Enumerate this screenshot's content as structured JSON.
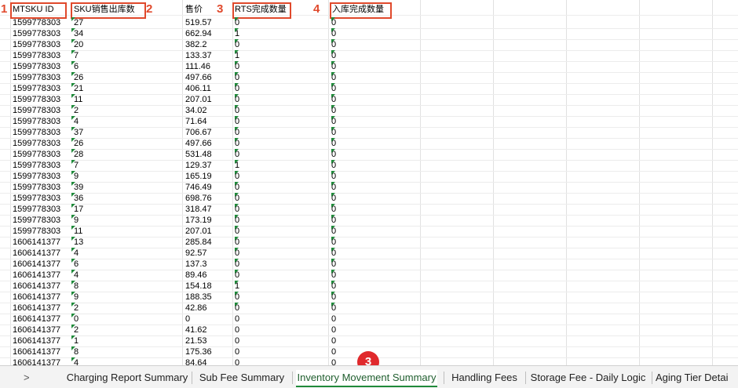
{
  "annotations": [
    "1",
    "2",
    "3",
    "4"
  ],
  "columns": {
    "mtsku_id": "MTSKU ID",
    "sku_sold": "SKU销售出库数",
    "price": "售价",
    "rts_done": "RTS完成数量",
    "inbound_done": "入库完成数量"
  },
  "rows": [
    [
      "1599778303",
      "27",
      "519.57",
      "0",
      "0"
    ],
    [
      "1599778303",
      "34",
      "662.94",
      "1",
      "0"
    ],
    [
      "1599778303",
      "20",
      "382.2",
      "0",
      "0"
    ],
    [
      "1599778303",
      "7",
      "133.37",
      "1",
      "0"
    ],
    [
      "1599778303",
      "6",
      "111.46",
      "0",
      "0"
    ],
    [
      "1599778303",
      "26",
      "497.66",
      "0",
      "0"
    ],
    [
      "1599778303",
      "21",
      "406.11",
      "0",
      "0"
    ],
    [
      "1599778303",
      "11",
      "207.01",
      "0",
      "0"
    ],
    [
      "1599778303",
      "2",
      "34.02",
      "0",
      "0"
    ],
    [
      "1599778303",
      "4",
      "71.64",
      "0",
      "0"
    ],
    [
      "1599778303",
      "37",
      "706.67",
      "0",
      "0"
    ],
    [
      "1599778303",
      "26",
      "497.66",
      "0",
      "0"
    ],
    [
      "1599778303",
      "28",
      "531.48",
      "0",
      "0"
    ],
    [
      "1599778303",
      "7",
      "129.37",
      "1",
      "0"
    ],
    [
      "1599778303",
      "9",
      "165.19",
      "0",
      "0"
    ],
    [
      "1599778303",
      "39",
      "746.49",
      "0",
      "0"
    ],
    [
      "1599778303",
      "36",
      "698.76",
      "0",
      "0"
    ],
    [
      "1599778303",
      "17",
      "318.47",
      "0",
      "0"
    ],
    [
      "1599778303",
      "9",
      "173.19",
      "0",
      "0"
    ],
    [
      "1599778303",
      "11",
      "207.01",
      "0",
      "0"
    ],
    [
      "1606141377",
      "13",
      "285.84",
      "0",
      "0"
    ],
    [
      "1606141377",
      "4",
      "92.57",
      "0",
      "0"
    ],
    [
      "1606141377",
      "6",
      "137.3",
      "0",
      "0"
    ],
    [
      "1606141377",
      "4",
      "89.46",
      "0",
      "0"
    ],
    [
      "1606141377",
      "8",
      "154.18",
      "1",
      "0"
    ],
    [
      "1606141377",
      "9",
      "188.35",
      "0",
      "0"
    ],
    [
      "1606141377",
      "2",
      "42.86",
      "0",
      "0"
    ],
    [
      "1606141377",
      "0",
      "0",
      "0",
      "0"
    ],
    [
      "1606141377",
      "2",
      "41.62",
      "0",
      "0"
    ],
    [
      "1606141377",
      "1",
      "21.53",
      "0",
      "0"
    ],
    [
      "1606141377",
      "8",
      "175.36",
      "0",
      "0"
    ],
    [
      "1606141377",
      "4",
      "84.64",
      "0",
      "0"
    ]
  ],
  "tabs": {
    "nav_arrow": ">",
    "items": [
      "Charging Report Summary",
      "Sub Fee Summary",
      "Inventory Movement Summary",
      "Handling Fees",
      "Storage Fee - Daily Logic",
      "Aging Tier Detai"
    ],
    "active": "Inventory Movement Summary"
  },
  "badge": "3",
  "colors": {
    "annotation": "#e0492c",
    "badge": "#e0292c",
    "active_tab": "#1f8a3a"
  }
}
